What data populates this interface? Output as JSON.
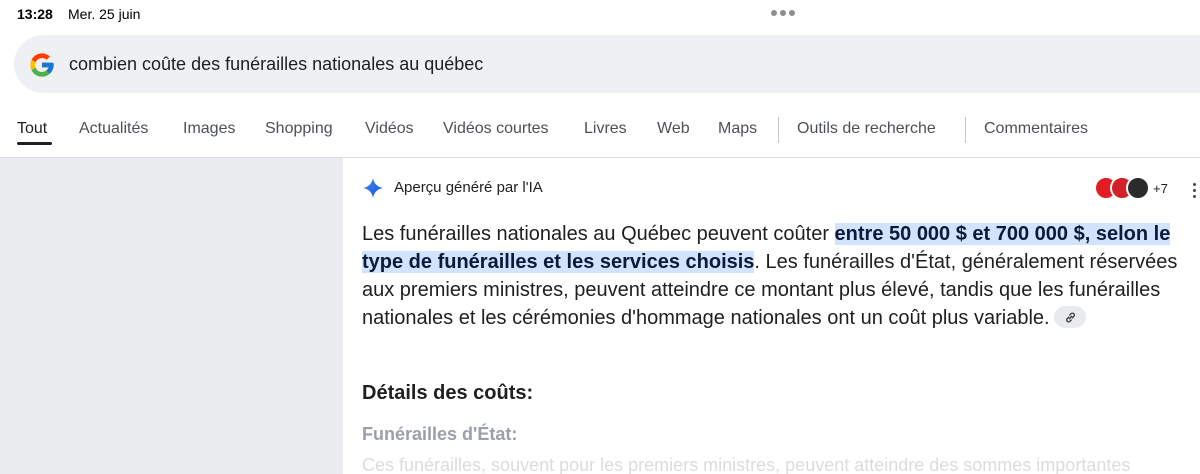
{
  "status": {
    "time": "13:28",
    "date": "Mer. 25 juin"
  },
  "search": {
    "query": "combien coûte des funérailles nationales au québec"
  },
  "tabs": [
    {
      "label": "Tout"
    },
    {
      "label": "Actualités"
    },
    {
      "label": "Images"
    },
    {
      "label": "Shopping"
    },
    {
      "label": "Vidéos"
    },
    {
      "label": "Vidéos courtes"
    },
    {
      "label": "Livres"
    },
    {
      "label": "Web"
    },
    {
      "label": "Maps"
    },
    {
      "label": "Outils de recherche"
    },
    {
      "label": "Commentaires"
    }
  ],
  "ai_overview": {
    "title": "Aperçu généré par l'IA",
    "sources_more": "+7",
    "answer_before": "Les funérailles nationales au Québec peuvent coûter ",
    "answer_highlight": "entre 50 000 $ et 700 000 $, selon le type de funérailles et les services choisis",
    "answer_after": ". Les funérailles d'État, généralement réservées aux premiers ministres, peuvent atteindre ce montant plus élevé, tandis que les funérailles nationales et les cérémonies d'hommage nationales ont un coût plus variable.",
    "details_title": "Détails des coûts:",
    "sub_title": "Funérailles d'État:",
    "faded_text": "Ces funérailles, souvent pour les premiers ministres, peuvent atteindre des sommes importantes"
  },
  "colors": {
    "highlight": "#d3e3fd",
    "left_panel": "#eaecef",
    "search_bg": "#eef0f3"
  }
}
